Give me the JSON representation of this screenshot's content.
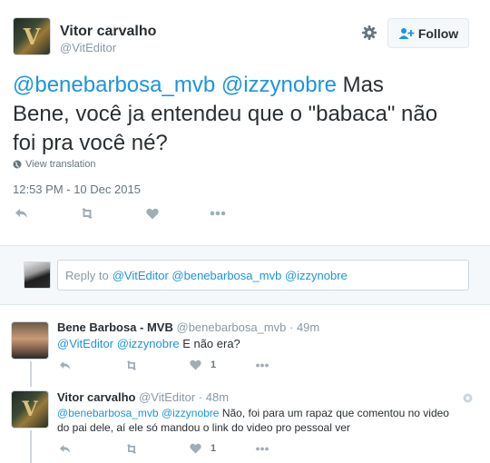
{
  "main_tweet": {
    "author_name": "Vitor carvalho",
    "author_handle": "@VitEditor",
    "follow_label": "Follow",
    "mention1": "@benebarbosa_mvb",
    "mention2": "@izzynobre",
    "text_line1_rest": "Mas",
    "text_line2": "Bene, você ja entendeu que o \"babaca\" não",
    "text_line3": "foi pra você né?",
    "view_translation": "View translation",
    "timestamp": "12:53 PM - 10 Dec 2015"
  },
  "reply_box": {
    "prefix": "Reply to",
    "mentions": "@VitEditor @benebarbosa_mvb @izzynobre"
  },
  "replies": [
    {
      "author_name": "Bene Barbosa - MVB",
      "author_handle": "@benebarbosa_mvb",
      "time": "· 49m",
      "mention1": "@VitEditor",
      "mention2": "@izzynobre",
      "text": "E não era?",
      "like_count": "1"
    },
    {
      "author_name": "Vitor carvalho",
      "author_handle": "@VitEditor",
      "time": "· 48m",
      "mention1": "@benebarbosa_mvb",
      "mention2": "@izzynobre",
      "text_line1": "Não, foi para um rapaz que comentou no video",
      "text_line2": "do pai dele, aí ele só mandou o link do video pro pessoal ver",
      "like_count": "1"
    }
  ],
  "colors": {
    "link": "#1b95e0",
    "muted": "#8899a6",
    "separator": "#e1e8ed"
  }
}
